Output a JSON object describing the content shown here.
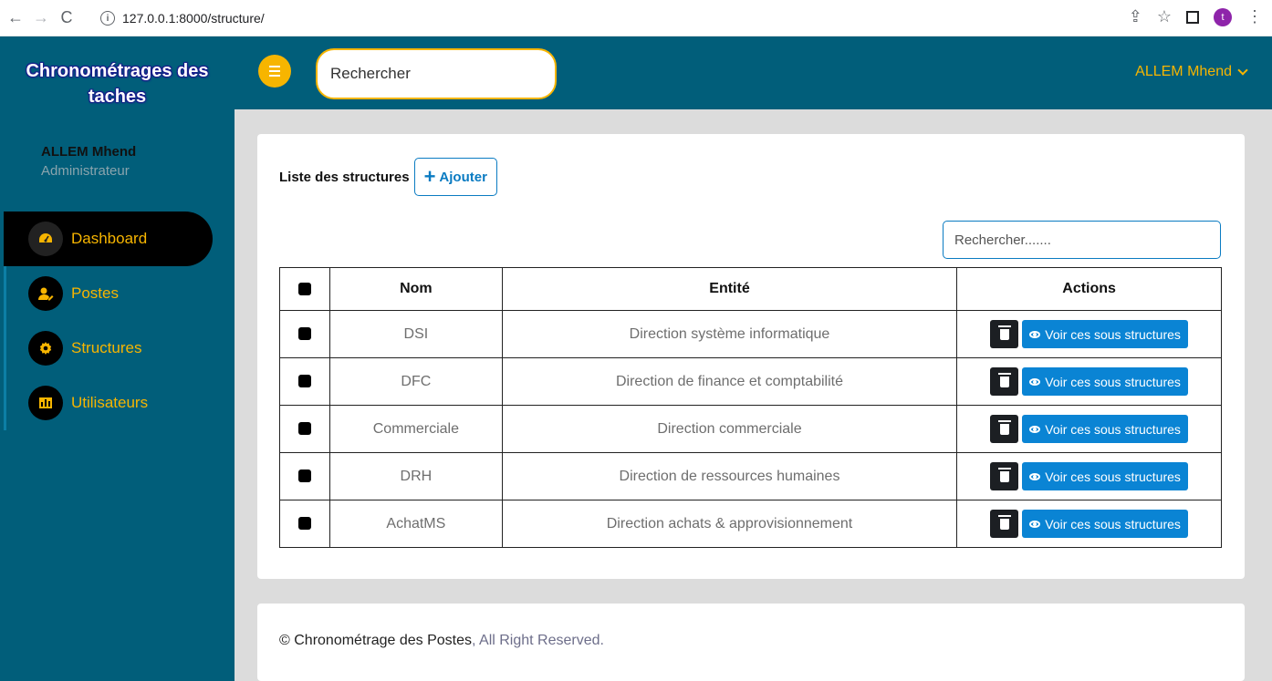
{
  "browser": {
    "url": "127.0.0.1:8000/structure/",
    "avatar_initial": "t"
  },
  "sidebar": {
    "brand": "Chronométrages des taches",
    "user_name": "ALLEM Mhend",
    "user_role": "Administrateur",
    "items": [
      {
        "label": "Dashboard",
        "icon": "gauge-icon"
      },
      {
        "label": "Postes",
        "icon": "user-edit-icon"
      },
      {
        "label": "Structures",
        "icon": "gear-icon"
      },
      {
        "label": "Utilisateurs",
        "icon": "chart-bar-icon"
      }
    ],
    "active_item": "Dashboard"
  },
  "topbar": {
    "search_placeholder": "Rechercher",
    "user": "ALLEM Mhend"
  },
  "main": {
    "title": "Liste des structures",
    "add_label": "Ajouter",
    "search_placeholder": "Rechercher.......",
    "columns": [
      "Nom",
      "Entité",
      "Actions"
    ],
    "rows": [
      {
        "nom": "DSI",
        "entite": "Direction système informatique"
      },
      {
        "nom": "DFC",
        "entite": "Direction de finance et comptabilité"
      },
      {
        "nom": "Commerciale",
        "entite": "Direction commerciale"
      },
      {
        "nom": "DRH",
        "entite": "Direction de ressources humaines"
      },
      {
        "nom": "AchatMS",
        "entite": "Direction achats & approvisionnement"
      }
    ],
    "view_label": "Voir ces sous structures"
  },
  "footer": {
    "copyright": "© Chronométrage des Postes",
    "rights": ", All Right Reserved."
  },
  "colors": {
    "primary": "#015e7a",
    "accent": "#f7b500",
    "button_blue": "#0a84d4"
  }
}
